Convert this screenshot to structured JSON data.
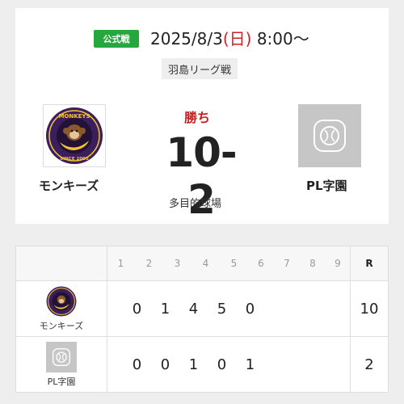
{
  "game": {
    "badge": "公式戦",
    "date": "2025/8/3",
    "dow_open": "(",
    "dow": "日",
    "dow_close": ")",
    "time": "8:00〜",
    "league": "羽島リーグ戦",
    "result": "勝ち",
    "score": "10-2",
    "venue": "多目的球場"
  },
  "teams": {
    "home": {
      "name": "モンキーズ",
      "logo_text_top": "MONKEYS",
      "logo_text_bottom": "SINCE 2005"
    },
    "away": {
      "name": "PL字園"
    }
  },
  "scoreboard": {
    "innings": [
      "1",
      "2",
      "3",
      "4",
      "5",
      "6",
      "7",
      "8",
      "9"
    ],
    "total_header": "R",
    "rows": [
      {
        "team": "モンキーズ",
        "scores": [
          "0",
          "1",
          "4",
          "5",
          "0",
          "",
          "",
          "",
          ""
        ],
        "total": "10"
      },
      {
        "team": "PL字園",
        "scores": [
          "0",
          "0",
          "1",
          "0",
          "1",
          "",
          "",
          "",
          ""
        ],
        "total": "2"
      }
    ]
  },
  "colors": {
    "badge": "#26a63e",
    "result": "#c62222",
    "dow": "#d11f1f",
    "logo_purple": "#3a1f5c",
    "logo_yellow": "#f4c430"
  }
}
